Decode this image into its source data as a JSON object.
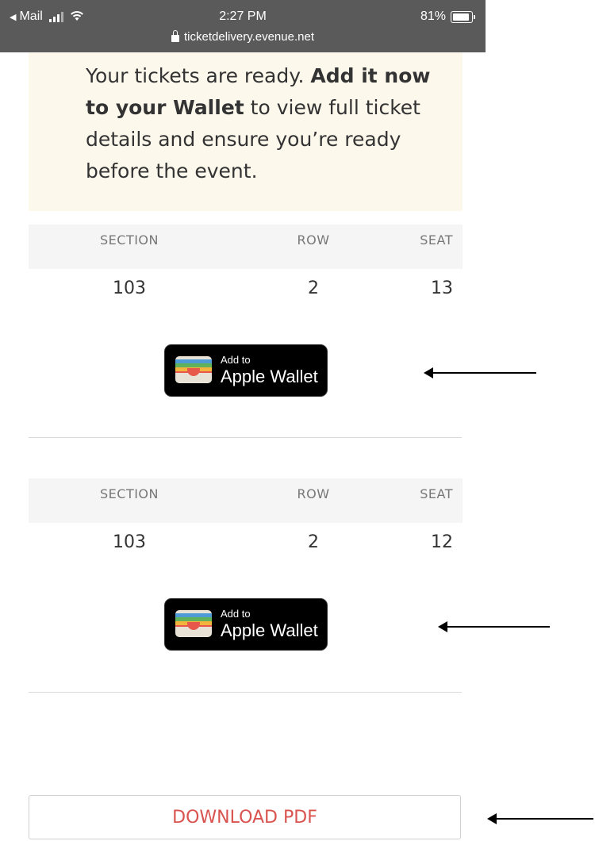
{
  "status_bar": {
    "back_app": "Mail",
    "time": "2:27 PM",
    "battery": "81%",
    "battery_level": 0.81,
    "url": "ticketdelivery.evenue.net"
  },
  "notice": {
    "text_before": "Your tickets are ready. ",
    "text_bold": "Add it now to your Wallet",
    "text_after": " to view full ticket details and ensure you’re ready before the event."
  },
  "headers": {
    "section": "SECTION",
    "row": "ROW",
    "seat": "SEAT"
  },
  "tickets": [
    {
      "section": "103",
      "row": "2",
      "seat": "13"
    },
    {
      "section": "103",
      "row": "2",
      "seat": "12"
    }
  ],
  "wallet_button": {
    "small": "Add to",
    "big": "Apple Wallet"
  },
  "download_button": "DOWNLOAD PDF",
  "colors": {
    "notice_bg": "#fdf8ec",
    "download_text": "#d9534f",
    "header_bg": "#f5f5f5"
  }
}
